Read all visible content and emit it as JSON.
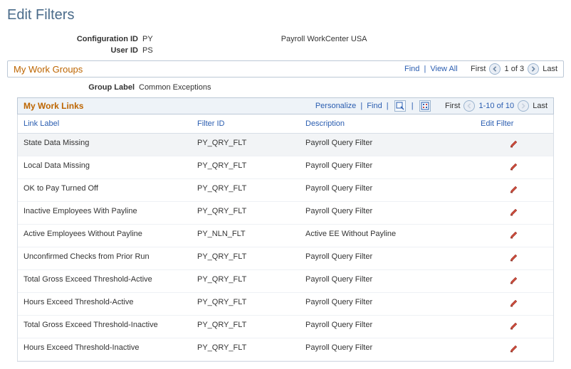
{
  "page": {
    "title": "Edit Filters"
  },
  "header": {
    "configLabel": "Configuration ID",
    "configVal": "PY",
    "configDesc": "Payroll WorkCenter USA",
    "userLabel": "User ID",
    "userVal": "PS"
  },
  "groupBar": {
    "title": "My Work Groups",
    "find": "Find",
    "viewAll": "View All",
    "first": "First",
    "pager": "1 of 3",
    "last": "Last"
  },
  "groupInfo": {
    "label": "Group Label",
    "value": "Common Exceptions"
  },
  "linksBar": {
    "title": "My Work Links",
    "personalize": "Personalize",
    "find": "Find",
    "first": "First",
    "pager": "1-10 of 10",
    "last": "Last"
  },
  "columns": {
    "linkLabel": "Link Label",
    "filterId": "Filter ID",
    "description": "Description",
    "editFilter": "Edit Filter"
  },
  "rows": [
    {
      "link": "State Data Missing",
      "filter": "PY_QRY_FLT",
      "desc": "Payroll Query Filter"
    },
    {
      "link": "Local Data Missing",
      "filter": "PY_QRY_FLT",
      "desc": "Payroll Query Filter"
    },
    {
      "link": "OK to Pay Turned Off",
      "filter": "PY_QRY_FLT",
      "desc": "Payroll Query Filter"
    },
    {
      "link": "Inactive Employees With Payline",
      "filter": "PY_QRY_FLT",
      "desc": "Payroll Query Filter"
    },
    {
      "link": "Active Employees Without Payline",
      "filter": "PY_NLN_FLT",
      "desc": "Active EE Without Payline"
    },
    {
      "link": "Unconfirmed Checks from Prior Run",
      "filter": "PY_QRY_FLT",
      "desc": "Payroll Query Filter"
    },
    {
      "link": "Total Gross Exceed Threshold-Active",
      "filter": "PY_QRY_FLT",
      "desc": "Payroll Query Filter"
    },
    {
      "link": "Hours Exceed Threshold-Active",
      "filter": "PY_QRY_FLT",
      "desc": "Payroll Query Filter"
    },
    {
      "link": "Total Gross Exceed Threshold-Inactive",
      "filter": "PY_QRY_FLT",
      "desc": "Payroll Query Filter"
    },
    {
      "link": "Hours Exceed Threshold-Inactive",
      "filter": "PY_QRY_FLT",
      "desc": "Payroll Query Filter"
    }
  ]
}
